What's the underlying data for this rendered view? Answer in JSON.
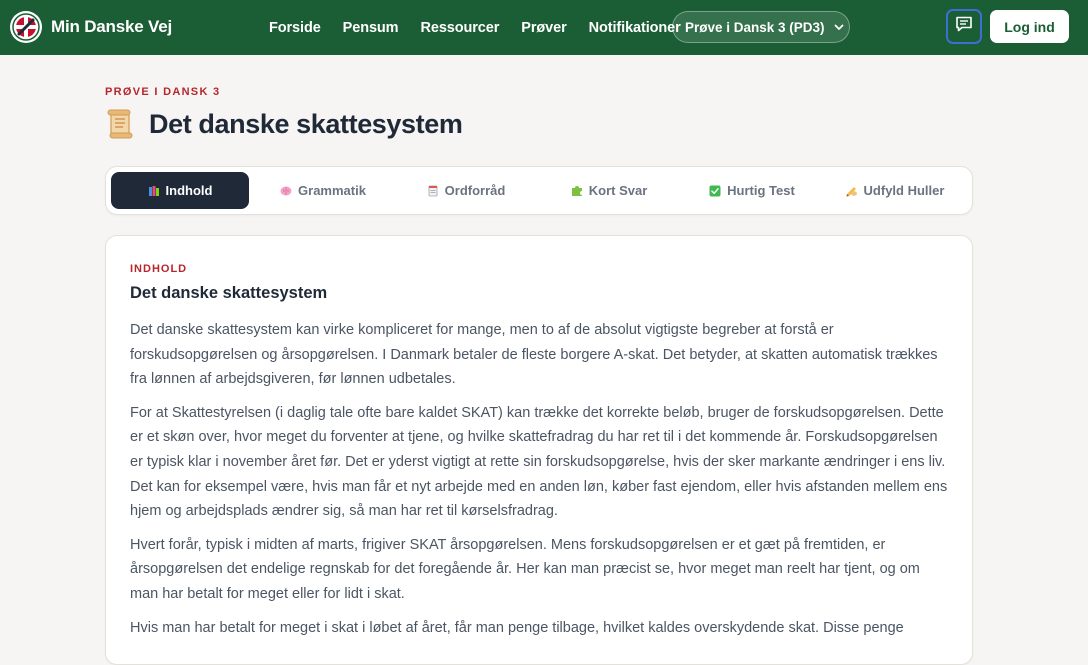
{
  "header": {
    "brand": "Min Danske Vej",
    "nav": [
      "Forside",
      "Pensum",
      "Ressourcer",
      "Prøver",
      "Notifikationer"
    ],
    "pill_label": "Prøve i Dansk 3 (PD3)",
    "login_label": "Log ind",
    "colors": {
      "bar": "#1b5e36",
      "accent": "#b5272d"
    }
  },
  "page": {
    "eyebrow": "PRØVE I DANSK 3",
    "title": "Det danske skattesystem",
    "title_icon": "scroll-icon"
  },
  "tabs": [
    {
      "label": "Indhold",
      "icon": "books-icon",
      "active": true
    },
    {
      "label": "Grammatik",
      "icon": "brain-icon",
      "active": false
    },
    {
      "label": "Ordforråd",
      "icon": "note-icon",
      "active": false
    },
    {
      "label": "Kort Svar",
      "icon": "puzzle-icon",
      "active": false
    },
    {
      "label": "Hurtig Test",
      "icon": "check-icon",
      "active": false
    },
    {
      "label": "Udfyld Huller",
      "icon": "writing-hand-icon",
      "active": false
    }
  ],
  "content": {
    "eyebrow": "INDHOLD",
    "title": "Det danske skattesystem",
    "paragraphs": [
      "Det danske skattesystem kan virke kompliceret for mange, men to af de absolut vigtigste begreber at forstå er forskudsopgørelsen og årsopgørelsen. I Danmark betaler de fleste borgere A-skat. Det betyder, at skatten automatisk trækkes fra lønnen af arbejdsgiveren, før lønnen udbetales.",
      "For at Skattestyrelsen (i daglig tale ofte bare kaldet SKAT) kan trække det korrekte beløb, bruger de forskudsopgørelsen. Dette er et skøn over, hvor meget du forventer at tjene, og hvilke skattefradrag du har ret til i det kommende år. Forskudsopgørelsen er typisk klar i november året før. Det er yderst vigtigt at rette sin forskudsopgørelse, hvis der sker markante ændringer i ens liv. Det kan for eksempel være, hvis man får et nyt arbejde med en anden løn, køber fast ejendom, eller hvis afstanden mellem ens hjem og arbejdsplads ændrer sig, så man har ret til kørselsfradrag.",
      "Hvert forår, typisk i midten af marts, frigiver SKAT årsopgørelsen. Mens forskudsopgørelsen er et gæt på fremtiden, er årsopgørelsen det endelige regnskab for det foregående år. Her kan man præcist se, hvor meget man reelt har tjent, og om man har betalt for meget eller for lidt i skat.",
      "Hvis man har betalt for meget i skat i løbet af året, får man penge tilbage, hvilket kaldes overskydende skat. Disse penge"
    ]
  }
}
